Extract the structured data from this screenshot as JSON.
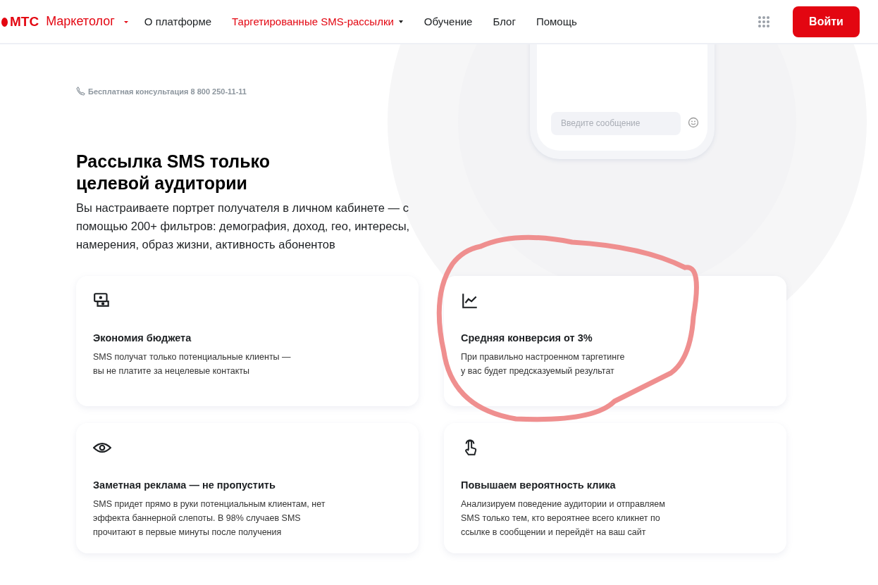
{
  "header": {
    "logo": "МТС",
    "product": "Маркетолог",
    "nav": [
      {
        "label": "О платформе",
        "selected": false,
        "has_menu": false
      },
      {
        "label": "Таргетированные SMS-рассылки",
        "selected": true,
        "has_menu": true
      },
      {
        "label": "Обучение",
        "selected": false,
        "has_menu": false
      },
      {
        "label": "Блог",
        "selected": false,
        "has_menu": false
      },
      {
        "label": "Помощь",
        "selected": false,
        "has_menu": false
      }
    ],
    "login_button": "Войти"
  },
  "consultation": "Бесплатная консультация 8 800 250-11-11",
  "phone_mockup": {
    "placeholder": "Введите сообщение"
  },
  "title": "Рассылка SMS только целевой аудитории",
  "subtitle": "Вы настраиваете портрет получателя в личном кабинете — с помощью 200+ фильтров: демография, доход, гео, интересы, намерения, образ жизни, активность абонентов",
  "features": [
    {
      "kind": "wallet",
      "title": "Экономия бюджета",
      "text": "SMS получат только потенциальные клиенты —\nвы не платите за нецелевые контакты"
    },
    {
      "kind": "chart",
      "title": "Средняя конверсия от 3%",
      "text": "При правильно настроенном таргетинге\nу вас будет предсказуемый результат"
    },
    {
      "kind": "eye",
      "title": "Заметная реклама — не пропустить",
      "text": "SMS придет прямо в руки потенциальным клиентам, нет\nэффекта баннерной слепоты. В 98% случаев SMS\nпрочитают в первые минуты после получения"
    },
    {
      "kind": "pointer",
      "title": "Повышаем вероятность клика",
      "text": "Анализируем поведение аудитории и отправляем\nSMS только тем, кто вероятнее всего кликнет по\nссылке в сообщении и перейдёт на ваш сайт"
    }
  ]
}
